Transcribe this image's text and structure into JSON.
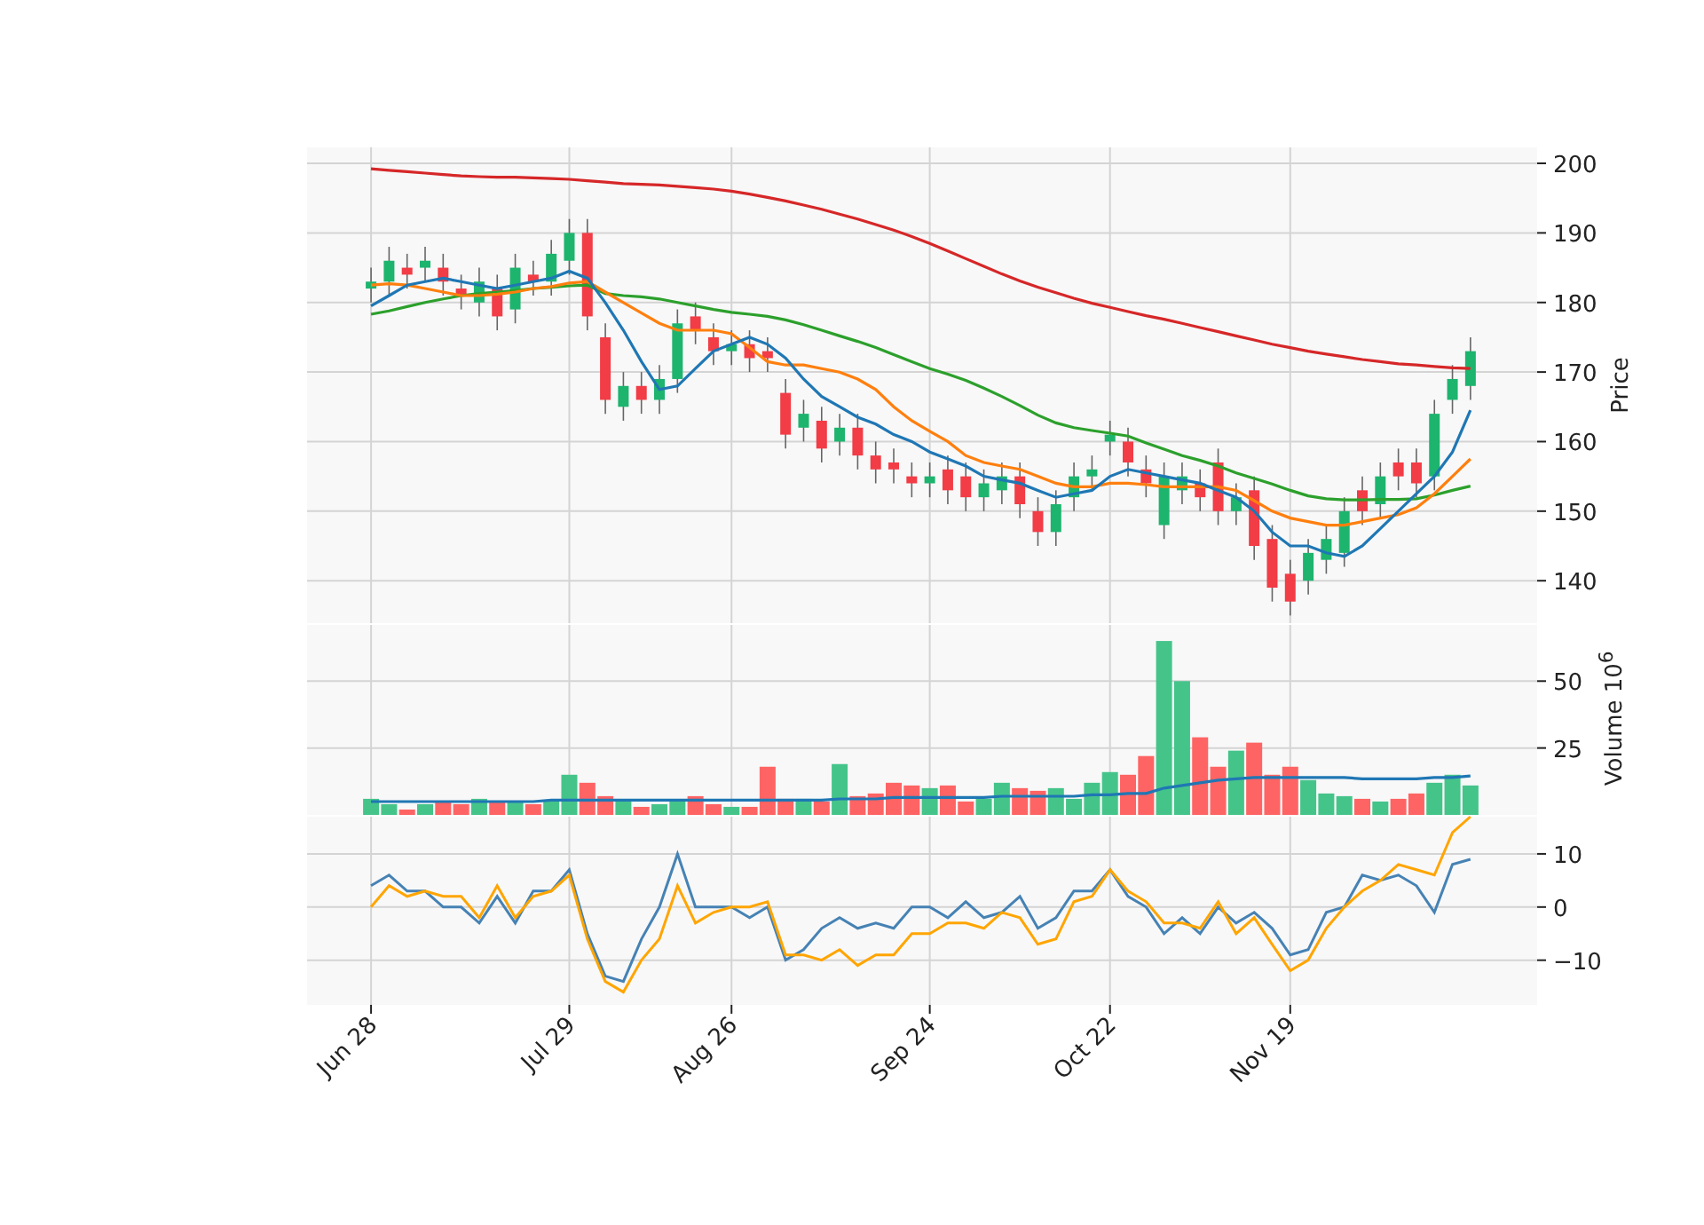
{
  "price_panel": {
    "chart_data": {
      "type": "candlestick",
      "ylabel": "Price",
      "ohlc": [
        [
          182,
          185,
          180,
          183
        ],
        [
          183,
          188,
          181,
          186
        ],
        [
          185,
          187,
          182,
          184
        ],
        [
          185,
          188,
          183,
          186
        ],
        [
          185,
          187,
          181,
          183
        ],
        [
          182,
          184,
          179,
          181
        ],
        [
          180,
          185,
          178,
          183
        ],
        [
          182,
          184,
          176,
          178
        ],
        [
          179,
          187,
          177,
          185
        ],
        [
          184,
          186,
          181,
          183
        ],
        [
          183,
          189,
          181,
          187
        ],
        [
          186,
          192,
          184,
          190
        ],
        [
          190,
          192,
          176,
          178
        ],
        [
          175,
          177,
          164,
          166
        ],
        [
          165,
          170,
          163,
          168
        ],
        [
          168,
          170,
          164,
          166
        ],
        [
          166,
          171,
          164,
          169
        ],
        [
          169,
          179,
          167,
          177
        ],
        [
          178,
          180,
          174,
          176
        ],
        [
          175,
          177,
          171,
          173
        ],
        [
          173,
          176,
          171,
          174
        ],
        [
          174,
          176,
          170,
          172
        ],
        [
          173,
          175,
          170,
          172
        ],
        [
          167,
          169,
          159,
          161
        ],
        [
          162,
          166,
          160,
          164
        ],
        [
          163,
          165,
          157,
          159
        ],
        [
          160,
          164,
          158,
          162
        ],
        [
          162,
          164,
          156,
          158
        ],
        [
          158,
          160,
          154,
          156
        ],
        [
          157,
          159,
          154,
          156
        ],
        [
          155,
          157,
          152,
          154
        ],
        [
          154,
          157,
          152,
          155
        ],
        [
          156,
          158,
          151,
          153
        ],
        [
          155,
          157,
          150,
          152
        ],
        [
          152,
          156,
          150,
          154
        ],
        [
          153,
          157,
          151,
          155
        ],
        [
          155,
          157,
          149,
          151
        ],
        [
          150,
          152,
          145,
          147
        ],
        [
          147,
          153,
          145,
          151
        ],
        [
          152,
          157,
          150,
          155
        ],
        [
          155,
          158,
          153,
          156
        ],
        [
          160,
          163,
          158,
          161
        ],
        [
          160,
          162,
          155,
          157
        ],
        [
          156,
          158,
          152,
          154
        ],
        [
          148,
          157,
          146,
          155
        ],
        [
          153,
          157,
          151,
          155
        ],
        [
          154,
          156,
          150,
          152
        ],
        [
          157,
          159,
          148,
          150
        ],
        [
          150,
          154,
          148,
          152
        ],
        [
          153,
          155,
          143,
          145
        ],
        [
          146,
          148,
          137,
          139
        ],
        [
          141,
          143,
          135,
          137
        ],
        [
          140,
          146,
          138,
          144
        ],
        [
          143,
          148,
          141,
          146
        ],
        [
          144,
          152,
          142,
          150
        ],
        [
          153,
          155,
          148,
          150
        ],
        [
          151,
          157,
          149,
          155
        ],
        [
          157,
          159,
          153,
          155
        ],
        [
          157,
          159,
          152,
          154
        ],
        [
          155,
          166,
          153,
          164
        ],
        [
          166,
          171,
          164,
          169
        ],
        [
          168,
          175,
          166,
          173
        ]
      ],
      "grid": true,
      "ylim": [
        133.9,
        202.3
      ],
      "yticks": [
        140,
        150,
        160,
        170,
        180,
        190,
        200
      ],
      "categories": [
        null,
        null,
        null,
        null,
        null,
        null,
        null,
        null,
        null,
        null,
        null,
        null,
        null,
        null,
        null,
        null,
        null,
        null,
        null,
        null,
        null,
        null,
        null,
        null,
        null,
        null,
        null,
        null,
        null,
        null,
        null,
        null,
        null,
        null,
        null,
        null,
        null,
        null,
        null,
        null,
        null,
        null,
        null,
        null,
        null,
        null,
        null,
        null,
        null,
        null,
        null,
        null,
        null,
        null,
        null,
        null,
        null,
        null,
        null,
        null,
        null,
        null
      ],
      "series": [
        {
          "type": "line",
          "color": "#d62728",
          "values": [
            199.2,
            199.0,
            198.8,
            198.6,
            198.4,
            198.2,
            198.1,
            198.0,
            198.0,
            197.9,
            197.8,
            197.7,
            197.5,
            197.3,
            197.1,
            197.0,
            196.9,
            196.7,
            196.5,
            196.3,
            196.0,
            195.6,
            195.1,
            194.6,
            194.0,
            193.4,
            192.7,
            192.0,
            191.2,
            190.4,
            189.5,
            188.5,
            187.4,
            186.3,
            185.2,
            184.1,
            183.1,
            182.2,
            181.4,
            180.6,
            179.9,
            179.3,
            178.7,
            178.1,
            177.6,
            177.0,
            176.4,
            175.8,
            175.2,
            174.6,
            174.0,
            173.5,
            173.0,
            172.6,
            172.2,
            171.8,
            171.5,
            171.2,
            171.0,
            170.8,
            170.6,
            170.5
          ]
        },
        {
          "type": "line",
          "color": "#2ca02c",
          "values": [
            178.3,
            178.8,
            179.4,
            180.0,
            180.5,
            181.0,
            181.3,
            181.5,
            181.7,
            182.0,
            182.2,
            182.4,
            182.5,
            181.3,
            181.0,
            180.8,
            180.5,
            180.0,
            179.5,
            179.0,
            178.6,
            178.3,
            178.0,
            177.5,
            176.8,
            176.0,
            175.2,
            174.4,
            173.5,
            172.5,
            171.5,
            170.5,
            169.7,
            168.8,
            167.7,
            166.5,
            165.2,
            163.8,
            162.7,
            162.0,
            161.6,
            161.2,
            160.8,
            159.8,
            158.9,
            158.0,
            157.3,
            156.5,
            155.5,
            154.7,
            153.9,
            153.0,
            152.2,
            151.8,
            151.6,
            151.6,
            151.7,
            151.7,
            151.8,
            152.3,
            153.0,
            153.6
          ]
        },
        {
          "type": "line",
          "color": "#ff7f0e",
          "values": [
            182.5,
            182.7,
            182.5,
            182.0,
            181.5,
            181.0,
            181.0,
            181.2,
            181.5,
            182.0,
            182.3,
            182.8,
            183.0,
            181.5,
            180.0,
            178.5,
            177.0,
            176.0,
            176.0,
            176.0,
            175.5,
            173.5,
            171.5,
            171.0,
            171.0,
            170.5,
            170.0,
            169.0,
            167.5,
            165.0,
            163.0,
            161.5,
            160.0,
            158.0,
            157.0,
            156.5,
            156.0,
            155.0,
            154.0,
            153.5,
            153.5,
            154.0,
            154.0,
            153.8,
            153.5,
            153.5,
            153.5,
            153.5,
            153.0,
            151.5,
            150.0,
            149.0,
            148.5,
            148.0,
            148.0,
            148.5,
            149.0,
            149.5,
            150.5,
            152.5,
            155.0,
            157.5
          ]
        },
        {
          "type": "line",
          "color": "#1f77b4",
          "values": [
            179.5,
            181.0,
            182.5,
            183.0,
            183.5,
            183.0,
            182.5,
            182.0,
            182.5,
            183.0,
            183.5,
            184.5,
            183.5,
            180.0,
            176.0,
            171.5,
            167.5,
            168.0,
            170.5,
            173.0,
            174.0,
            175.0,
            174.0,
            172.0,
            169.0,
            166.5,
            165.0,
            163.5,
            162.5,
            161.0,
            160.0,
            158.5,
            157.5,
            156.5,
            155.0,
            154.5,
            154.0,
            153.0,
            152.0,
            152.5,
            153.0,
            155.0,
            156.0,
            155.5,
            155.0,
            154.5,
            154.0,
            153.0,
            152.0,
            150.0,
            147.0,
            145.0,
            145.0,
            144.0,
            143.5,
            145.0,
            147.5,
            150.0,
            152.5,
            155.0,
            158.5,
            164.5
          ]
        }
      ]
    }
  },
  "volume_panel": {
    "chart_data": {
      "type": "bar",
      "ylabel": "Volume  10$^{6}$",
      "grid": true,
      "ylim": [
        0,
        71
      ],
      "yticks": [
        25,
        50
      ],
      "categories": [
        null,
        null,
        null,
        null,
        null,
        null,
        null,
        null,
        null,
        null,
        null,
        null,
        null,
        null,
        null,
        null,
        null,
        null,
        null,
        null,
        null,
        null,
        null,
        null,
        null,
        null,
        null,
        null,
        null,
        null,
        null,
        null,
        null,
        null,
        null,
        null,
        null,
        null,
        null,
        null,
        null,
        null,
        null,
        null,
        null,
        null,
        null,
        null,
        null,
        null,
        null,
        null,
        null,
        null,
        null,
        null,
        null,
        null,
        null,
        null,
        null,
        null
      ],
      "series": [
        {
          "colors": [
            "#45c48a",
            "#45c48a",
            "#ff6464",
            "#45c48a",
            "#ff6464",
            "#ff6464",
            "#45c48a",
            "#ff6464",
            "#45c48a",
            "#ff6464",
            "#45c48a",
            "#45c48a",
            "#ff6464",
            "#ff6464",
            "#45c48a",
            "#ff6464",
            "#45c48a",
            "#45c48a",
            "#ff6464",
            "#ff6464",
            "#45c48a",
            "#ff6464",
            "#ff6464",
            "#ff6464",
            "#45c48a",
            "#ff6464",
            "#45c48a",
            "#ff6464",
            "#ff6464",
            "#ff6464",
            "#ff6464",
            "#45c48a",
            "#ff6464",
            "#ff6464",
            "#45c48a",
            "#45c48a",
            "#ff6464",
            "#ff6464",
            "#45c48a",
            "#45c48a",
            "#45c48a",
            "#45c48a",
            "#ff6464",
            "#ff6464",
            "#45c48a",
            "#45c48a",
            "#ff6464",
            "#ff6464",
            "#45c48a",
            "#ff6464",
            "#ff6464",
            "#ff6464",
            "#45c48a",
            "#45c48a",
            "#45c48a",
            "#ff6464",
            "#45c48a",
            "#ff6464",
            "#ff6464",
            "#45c48a",
            "#45c48a",
            "#45c48a"
          ],
          "values": [
            6,
            4,
            2,
            4,
            5,
            4,
            6,
            5,
            5,
            4,
            5,
            15,
            12,
            7,
            5,
            3,
            4,
            5,
            7,
            4,
            3,
            3,
            18,
            6,
            6,
            5,
            19,
            7,
            8,
            12,
            11,
            10,
            11,
            5,
            6,
            12,
            10,
            9,
            10,
            6,
            12,
            16,
            15,
            22,
            65,
            50,
            29,
            18,
            24,
            27,
            15,
            18,
            13,
            8,
            7,
            6,
            5,
            6,
            8,
            12,
            15,
            11
          ]
        },
        {
          "type": "line",
          "color": "#1f77b4",
          "values": [
            5,
            5,
            5,
            5,
            5,
            5,
            5,
            5,
            5,
            5,
            5.5,
            5.5,
            5.5,
            5.5,
            5.5,
            5.5,
            5.5,
            5.5,
            5.5,
            5.5,
            5.5,
            5.5,
            5.5,
            5.5,
            5.5,
            5.5,
            6,
            6,
            6,
            6.5,
            6.5,
            6.5,
            6.5,
            6.5,
            6.5,
            7,
            7,
            7,
            7,
            7,
            7.5,
            7.5,
            8,
            8,
            10,
            11,
            12,
            13,
            13.5,
            14,
            14,
            14,
            14,
            14,
            14,
            13.5,
            13.5,
            13.5,
            13.5,
            14,
            14,
            14.5
          ]
        }
      ]
    }
  },
  "oscillator_panel": {
    "chart_data": {
      "type": "line",
      "grid": true,
      "ylim": [
        -18.4,
        17
      ],
      "yticks": [
        {
          "value": -10,
          "label": "−10"
        },
        0,
        10
      ],
      "categories": [
        "Jun 28",
        null,
        null,
        null,
        null,
        null,
        null,
        null,
        null,
        null,
        null,
        "Jul 29",
        null,
        null,
        null,
        null,
        null,
        null,
        null,
        null,
        "Aug 26",
        null,
        null,
        null,
        null,
        null,
        null,
        null,
        null,
        null,
        null,
        "Sep 24",
        null,
        null,
        null,
        null,
        null,
        null,
        null,
        null,
        null,
        "Oct 22",
        null,
        null,
        null,
        null,
        null,
        null,
        null,
        null,
        null,
        "Nov 19",
        null,
        null,
        null,
        null,
        null,
        null,
        null,
        null,
        null,
        null
      ],
      "series": [
        {
          "color": "#4682b4",
          "values": [
            4,
            6,
            3,
            3,
            0,
            0,
            -3,
            2,
            -3,
            3,
            3,
            7,
            -5,
            -13,
            -14,
            -6,
            0,
            10,
            0,
            0,
            0,
            -2,
            0,
            -10,
            -8,
            -4,
            -2,
            -4,
            -3,
            -4,
            0,
            0,
            -2,
            1,
            -2,
            -1,
            2,
            -4,
            -2,
            3,
            3,
            7,
            2,
            0,
            -5,
            -2,
            -5,
            0,
            -3,
            -1,
            -4,
            -9,
            -8,
            -1,
            0,
            6,
            5,
            6,
            4,
            -1,
            8,
            9
          ]
        },
        {
          "color": "#ffa500",
          "values": [
            0,
            4,
            2,
            3,
            2,
            2,
            -2,
            4,
            -2,
            2,
            3,
            6,
            -6,
            -14,
            -16,
            -10,
            -6,
            4,
            -3,
            -1,
            0,
            0,
            1,
            -9,
            -9,
            -10,
            -8,
            -11,
            -9,
            -9,
            -5,
            -5,
            -3,
            -3,
            -4,
            -1,
            -2,
            -7,
            -6,
            1,
            2,
            7,
            3,
            1,
            -3,
            -3,
            -4,
            1,
            -5,
            -2,
            -7,
            -12,
            -10,
            -4,
            0,
            3,
            5,
            8,
            7,
            6,
            14,
            17
          ]
        }
      ]
    }
  }
}
